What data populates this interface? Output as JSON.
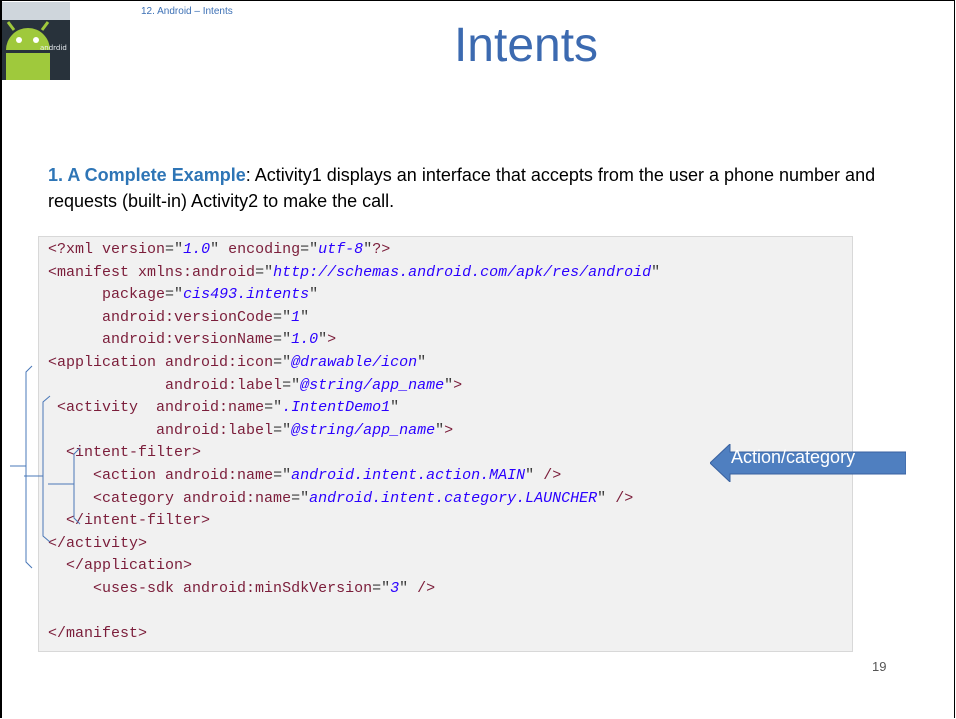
{
  "header": {
    "breadcrumb": "12. Android – Intents",
    "title": "Intents"
  },
  "logo": {
    "icon": "android-robot-icon",
    "text": "andrdid"
  },
  "intro": {
    "lead": "1. A Complete Example",
    "body": ":  Activity1  displays an interface that accepts from the user a phone number and requests (built-in) Activity2 to make the call."
  },
  "code": {
    "lines": [
      "<?xml version=\"1.0\" encoding=\"utf-8\"?>",
      "<manifest xmlns:android=\"http://schemas.android.com/apk/res/android\"",
      "      package=\"cis493.intents\"",
      "      android:versionCode=\"1\"",
      "      android:versionName=\"1.0\">",
      "<application android:icon=\"@drawable/icon\"",
      "             android:label=\"@string/app_name\">",
      " <activity  android:name=\".IntentDemo1\"",
      "            android:label=\"@string/app_name\">",
      "  <intent-filter>",
      "     <action android:name=\"android.intent.action.MAIN\" />",
      "     <category android:name=\"android.intent.category.LAUNCHER\" />",
      "  </intent-filter>",
      "</activity>",
      "  </application>",
      "     <uses-sdk android:minSdkVersion=\"3\" />",
      "",
      "</manifest>"
    ]
  },
  "callout": {
    "label": "Action/category",
    "color": "#4f7fc0"
  },
  "page_number": "19"
}
